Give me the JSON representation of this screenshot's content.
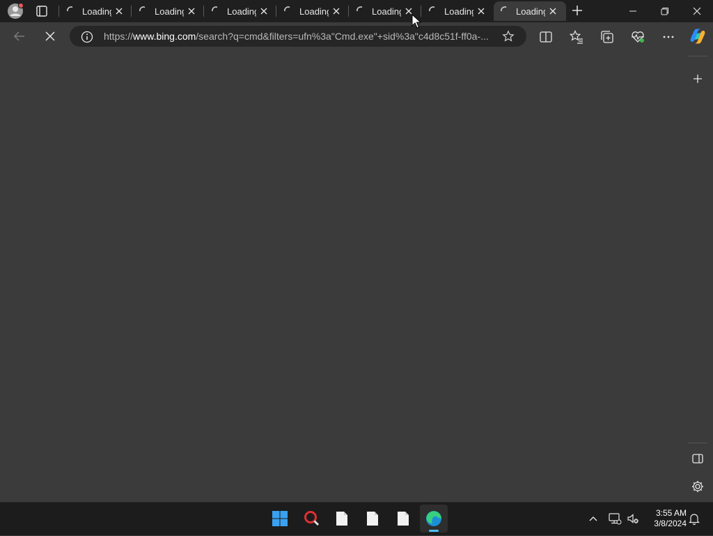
{
  "browser": {
    "tabs": [
      {
        "label": "Loading",
        "active": false
      },
      {
        "label": "Loading",
        "active": false
      },
      {
        "label": "Loading",
        "active": false
      },
      {
        "label": "Loading",
        "active": false
      },
      {
        "label": "Loading",
        "active": false
      },
      {
        "label": "Loading",
        "active": false
      },
      {
        "label": "Loading",
        "active": true
      }
    ],
    "address": {
      "prefix": "https://",
      "domain": "www.bing.com",
      "rest": "/search?q=cmd&filters=ufn%3a\"Cmd.exe\"+sid%3a\"c4d8c51f-ff0a-..."
    }
  },
  "taskbar": {
    "clock": {
      "time": "3:55 AM",
      "date": "3/8/2024"
    }
  },
  "colors": {
    "titlebar": "#1f1f1f",
    "page": "#3b3b3b",
    "taskbar": "#1c1c1c",
    "accent": "#4cc2ff"
  }
}
